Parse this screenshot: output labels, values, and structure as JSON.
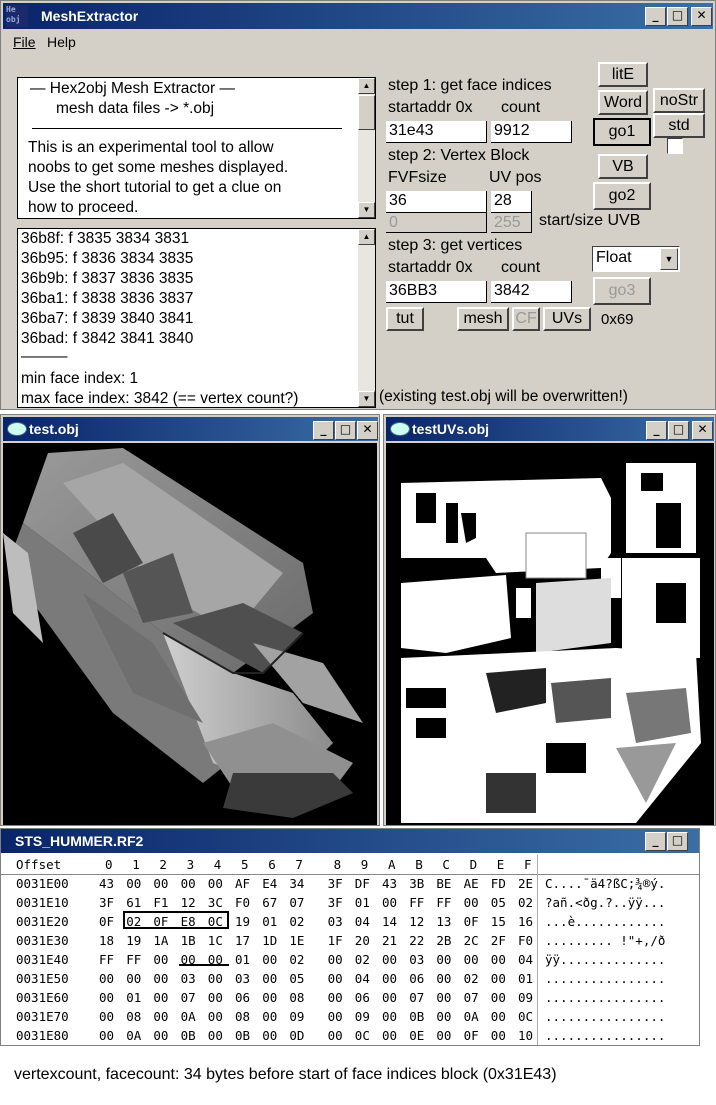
{
  "main_window": {
    "title": "MeshExtractor",
    "menu": [
      "File",
      "Help"
    ],
    "info_text": {
      "header1": "—   Hex2obj Mesh Extractor   —",
      "header2": "mesh data files -> *.obj",
      "body": [
        "This is an experimental tool to allow",
        "noobs to get some meshes displayed.",
        "Use the short tutorial to get a clue on",
        "how to proceed."
      ]
    },
    "log_lines": [
      "36b8f: f  3835 3834 3831",
      "36b95: f  3836 3834 3835",
      "36b9b: f  3837 3836 3835",
      "36ba1: f  3838 3836 3837",
      "36ba7: f  3839 3840 3841",
      "36bad: f  3842 3841 3840",
      "———",
      "min face index: 1",
      "max face index: 3842 (== vertex count?)"
    ],
    "step1": {
      "title": "step 1: get face indices",
      "startaddr_label": "startaddr 0x",
      "count_label": "count",
      "startaddr": "31e43",
      "count": "9912"
    },
    "step2": {
      "title": "step 2: Vertex Block",
      "fvf_label": "FVFsize",
      "uvpos_label": "UV pos",
      "fvf": "36",
      "uvpos": "28",
      "uvb_start": "0",
      "uvb_size": "255",
      "uvb_label": "start/size UVB"
    },
    "step3": {
      "title": "step 3: get vertices",
      "startaddr_label": "startaddr 0x",
      "count_label": "count",
      "startaddr": "36BB3",
      "count": "3842"
    },
    "buttons": {
      "lite": "litE",
      "word": "Word",
      "nostr": "noStr",
      "go1": "go1",
      "std": "std",
      "vb": "VB",
      "go2": "go2",
      "go3": "go3",
      "tut": "tut",
      "mesh": "mesh",
      "cf": "CF",
      "uvs": "UVs"
    },
    "format_select": "Float",
    "hex_label": "0x69",
    "warning": "(existing test.obj will be overwritten!)"
  },
  "test_window": {
    "title": "test.obj"
  },
  "uv_window": {
    "title": "testUVs.obj"
  },
  "hex_window": {
    "title": "STS_HUMMER.RF2",
    "offset_header": "Offset",
    "columns": [
      "0",
      "1",
      "2",
      "3",
      "4",
      "5",
      "6",
      "7",
      "8",
      "9",
      "A",
      "B",
      "C",
      "D",
      "E",
      "F"
    ],
    "rows": [
      {
        "offset": "0031E00",
        "bytes": [
          "43",
          "00",
          "00",
          "00",
          "00",
          "AF",
          "E4",
          "34",
          "3F",
          "DF",
          "43",
          "3B",
          "BE",
          "AE",
          "FD",
          "2E"
        ],
        "ascii": "C....¯ä4?ßC;¾®ý."
      },
      {
        "offset": "0031E10",
        "bytes": [
          "3F",
          "61",
          "F1",
          "12",
          "3C",
          "F0",
          "67",
          "07",
          "3F",
          "01",
          "00",
          "FF",
          "FF",
          "00",
          "05",
          "02"
        ],
        "ascii": "?añ.<ðg.?..ÿÿ..."
      },
      {
        "offset": "0031E20",
        "bytes": [
          "0F",
          "02",
          "0F",
          "E8",
          "0C",
          "19",
          "01",
          "02",
          "03",
          "04",
          "14",
          "12",
          "13",
          "0F",
          "15",
          "16"
        ],
        "ascii": "...è............"
      },
      {
        "offset": "0031E30",
        "bytes": [
          "18",
          "19",
          "1A",
          "1B",
          "1C",
          "17",
          "1D",
          "1E",
          "1F",
          "20",
          "21",
          "22",
          "2B",
          "2C",
          "2F",
          "F0"
        ],
        "ascii": "......... !\"+,/ð"
      },
      {
        "offset": "0031E40",
        "bytes": [
          "FF",
          "FF",
          "00",
          "00",
          "00",
          "01",
          "00",
          "02",
          "00",
          "02",
          "00",
          "03",
          "00",
          "00",
          "00",
          "04"
        ],
        "ascii": "ÿÿ.............."
      },
      {
        "offset": "0031E50",
        "bytes": [
          "00",
          "00",
          "00",
          "03",
          "00",
          "03",
          "00",
          "05",
          "00",
          "04",
          "00",
          "06",
          "00",
          "02",
          "00",
          "01"
        ],
        "ascii": "................"
      },
      {
        "offset": "0031E60",
        "bytes": [
          "00",
          "01",
          "00",
          "07",
          "00",
          "06",
          "00",
          "08",
          "00",
          "06",
          "00",
          "07",
          "00",
          "07",
          "00",
          "09"
        ],
        "ascii": "................"
      },
      {
        "offset": "0031E70",
        "bytes": [
          "00",
          "08",
          "00",
          "0A",
          "00",
          "08",
          "00",
          "09",
          "00",
          "09",
          "00",
          "0B",
          "00",
          "0A",
          "00",
          "0C"
        ],
        "ascii": "................"
      },
      {
        "offset": "0031E80",
        "bytes": [
          "00",
          "0A",
          "00",
          "0B",
          "00",
          "0B",
          "00",
          "0D",
          "00",
          "0C",
          "00",
          "0E",
          "00",
          "0F",
          "00",
          "10"
        ],
        "ascii": "................"
      }
    ]
  },
  "caption": "vertexcount, facecount: 34 bytes before start of face indices block (0x31E43)"
}
